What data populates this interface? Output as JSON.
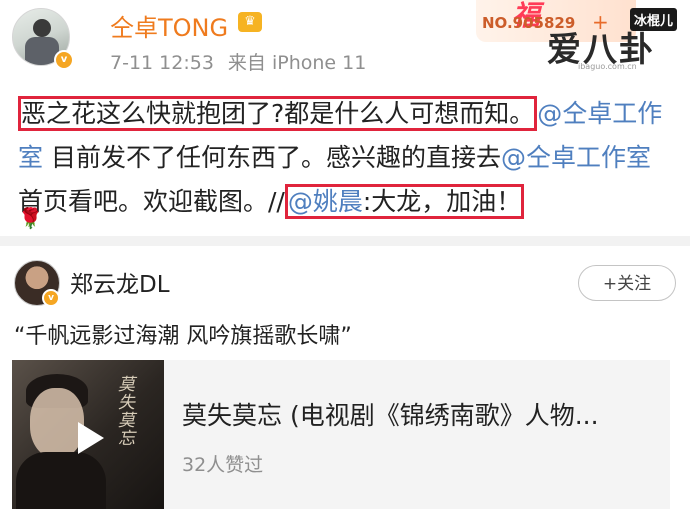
{
  "header": {
    "username": "仝卓TONG",
    "vip_icon": "crown-icon",
    "time": "7-11 12:53",
    "source": "来自 iPhone 11",
    "card_number": "NO.905829",
    "card_plus": "+"
  },
  "watermark": {
    "brand": "冰棍儿",
    "site": "爱八卦",
    "url": "ibaguo.com.cn"
  },
  "post": {
    "text1": "恶之花这么快就抱团了?都是什么人可想而知。",
    "mention1": "@仝卓工作室",
    "text2": " 目前发不了任何东西了。感兴趣的直接去",
    "mention2": "@仝卓工作室",
    "text3": " 首页看吧。欢迎截图。//",
    "mention3": "@姚晨",
    "text4": ":大龙，加油！",
    "emoji": "rose-icon"
  },
  "shared": {
    "username": "郑云龙DL",
    "follow_label": "+关注",
    "quote": "“千帆远影过海潮  风吟旗摇歌长啸”",
    "media_title": "莫失莫忘 (电视剧《锦绣南歌》人物...",
    "media_likes": "32人赞过",
    "cover_calligraphy": "莫失莫忘"
  },
  "colors": {
    "username": "#ef7b1e",
    "link": "#4f7fbf",
    "highlight_box": "#e0243c",
    "meta": "#8f8f8f"
  }
}
